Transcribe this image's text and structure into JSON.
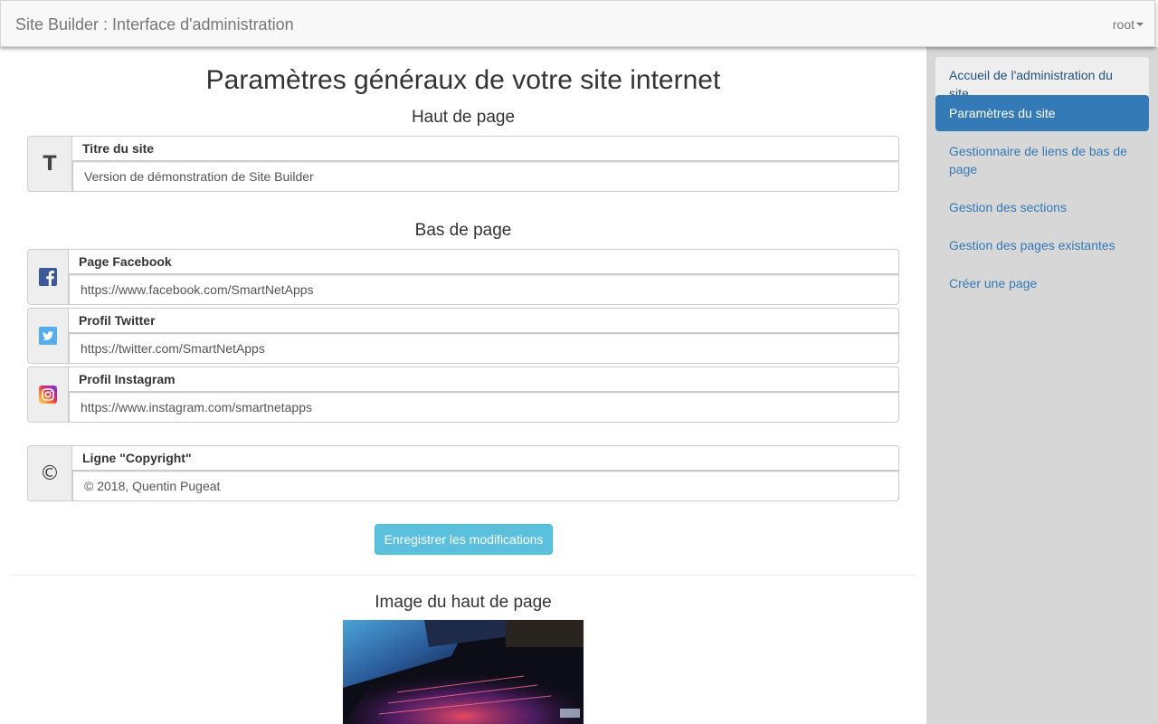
{
  "navbar": {
    "brand": "Site Builder : Interface d'administration",
    "user": "root"
  },
  "sidebar": {
    "items": [
      {
        "label": "Accueil de l'administration du site"
      },
      {
        "label": "Paramètres du site"
      },
      {
        "label": "Gestionnaire de liens de bas de page"
      },
      {
        "label": "Gestion des sections"
      },
      {
        "label": "Gestion des pages existantes"
      },
      {
        "label": "Créer une page"
      }
    ]
  },
  "main": {
    "title": "Paramètres généraux de votre site internet",
    "header_section": {
      "title": "Haut de page",
      "site_title_label": "Titre du site",
      "site_title_value": "Version de démonstration de Site Builder",
      "site_title_icon": "T"
    },
    "footer_section": {
      "title": "Bas de page",
      "facebook_label": "Page Facebook",
      "facebook_value": "https://www.facebook.com/SmartNetApps",
      "twitter_label": "Profil Twitter",
      "twitter_value": "https://twitter.com/SmartNetApps",
      "instagram_label": "Profil Instagram",
      "instagram_value": "https://www.instagram.com/smartnetapps",
      "copyright_label": "Ligne \"Copyright\"",
      "copyright_value": "© 2018, Quentin Pugeat",
      "copyright_icon": "©"
    },
    "save_button": "Enregistrer les modifications",
    "header_image_title": "Image du haut de page"
  },
  "colors": {
    "primary": "#337ab7",
    "info_button": "#5bc0de",
    "sidebar_bg": "#d7d7d7",
    "facebook": "#3b5998",
    "twitter": "#55acee"
  }
}
